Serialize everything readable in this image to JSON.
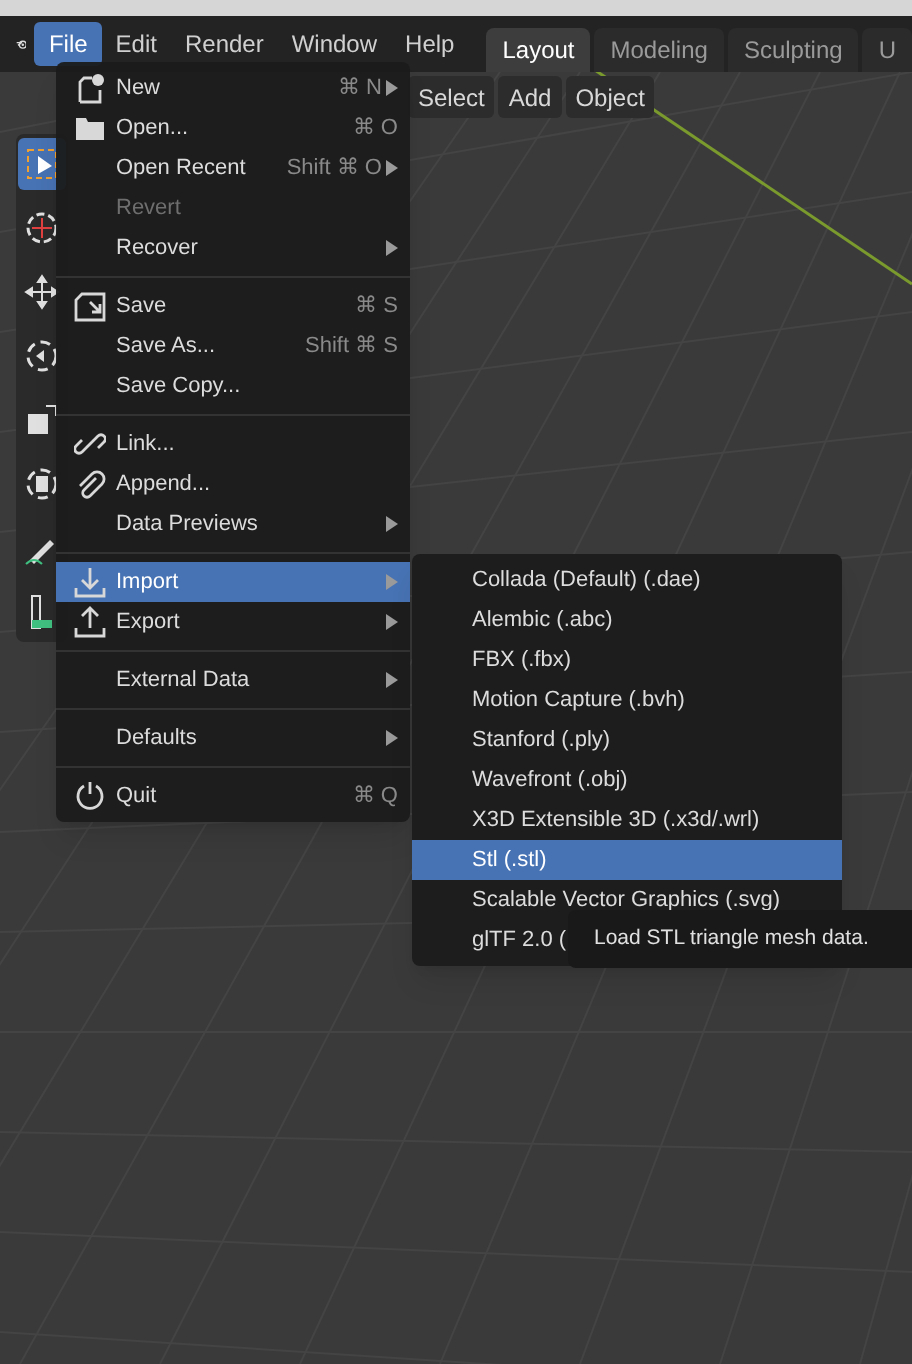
{
  "menubar": [
    {
      "label": "File",
      "selected": true
    },
    {
      "label": "Edit",
      "selected": false
    },
    {
      "label": "Render",
      "selected": false
    },
    {
      "label": "Window",
      "selected": false
    },
    {
      "label": "Help",
      "selected": false
    }
  ],
  "workspace_tabs": [
    {
      "label": "Layout",
      "selected": true
    },
    {
      "label": "Modeling",
      "selected": false
    },
    {
      "label": "Sculpting",
      "selected": false
    },
    {
      "label": "U",
      "selected": false
    }
  ],
  "header_buttons": [
    "Select",
    "Add",
    "Object"
  ],
  "toolbar": [
    {
      "selected": true
    },
    {
      "selected": false
    },
    {
      "selected": false
    },
    {
      "selected": false
    },
    {
      "selected": false
    },
    {
      "selected": false
    },
    {
      "selected": false
    },
    {
      "selected": false
    }
  ],
  "file_menu": {
    "sections": [
      {
        "items": [
          {
            "label": "New",
            "shortcut": "⌘ N",
            "submenu": true,
            "disabled": false,
            "selected": false
          },
          {
            "label": "Open...",
            "shortcut": "⌘ O",
            "submenu": false,
            "disabled": false,
            "selected": false
          },
          {
            "label": "Open Recent",
            "shortcut": "Shift ⌘ O",
            "submenu": true,
            "disabled": false,
            "selected": false
          },
          {
            "label": "Revert",
            "submenu": false,
            "disabled": true,
            "selected": false
          },
          {
            "label": "Recover",
            "submenu": true,
            "disabled": false,
            "selected": false
          }
        ]
      },
      {
        "items": [
          {
            "label": "Save",
            "shortcut": "⌘ S",
            "submenu": false,
            "disabled": false,
            "selected": false
          },
          {
            "label": "Save As...",
            "shortcut": "Shift ⌘ S",
            "submenu": false,
            "disabled": false,
            "selected": false
          },
          {
            "label": "Save Copy...",
            "submenu": false,
            "disabled": false,
            "selected": false
          }
        ]
      },
      {
        "items": [
          {
            "label": "Link...",
            "submenu": false,
            "disabled": false,
            "selected": false
          },
          {
            "label": "Append...",
            "submenu": false,
            "disabled": false,
            "selected": false
          },
          {
            "label": "Data Previews",
            "submenu": true,
            "disabled": false,
            "selected": false
          }
        ]
      },
      {
        "items": [
          {
            "label": "Import",
            "submenu": true,
            "disabled": false,
            "selected": true
          },
          {
            "label": "Export",
            "submenu": true,
            "disabled": false,
            "selected": false
          }
        ]
      },
      {
        "items": [
          {
            "label": "External Data",
            "submenu": true,
            "disabled": false,
            "selected": false
          }
        ]
      },
      {
        "items": [
          {
            "label": "Defaults",
            "submenu": true,
            "disabled": false,
            "selected": false
          }
        ]
      },
      {
        "items": [
          {
            "label": "Quit",
            "shortcut": "⌘ Q",
            "submenu": false,
            "disabled": false,
            "selected": false
          }
        ]
      }
    ]
  },
  "import_menu": [
    {
      "label": "Collada (Default) (.dae)",
      "selected": false
    },
    {
      "label": "Alembic (.abc)",
      "selected": false
    },
    {
      "label": "FBX (.fbx)",
      "selected": false
    },
    {
      "label": "Motion Capture (.bvh)",
      "selected": false
    },
    {
      "label": "Stanford (.ply)",
      "selected": false
    },
    {
      "label": "Wavefront (.obj)",
      "selected": false
    },
    {
      "label": "X3D Extensible 3D (.x3d/.wrl)",
      "selected": false
    },
    {
      "label": "Stl (.stl)",
      "selected": true
    },
    {
      "label": "Scalable Vector Graphics (.svg)",
      "selected": false
    },
    {
      "label": "glTF 2.0 (",
      "selected": false
    }
  ],
  "tooltip": "Load STL triangle mesh data."
}
